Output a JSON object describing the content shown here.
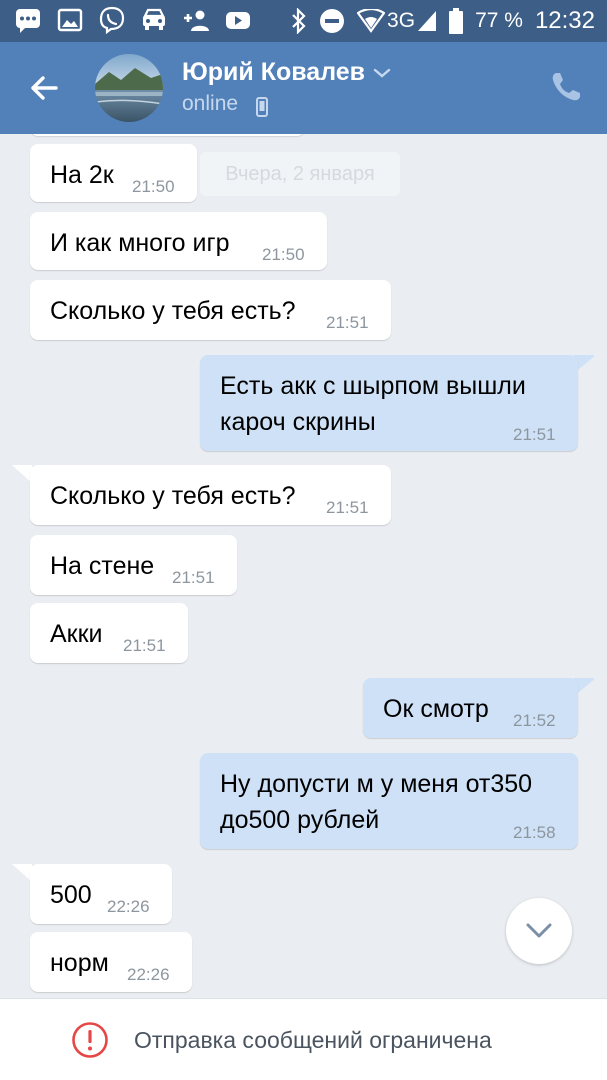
{
  "status_bar": {
    "icons": [
      "chat-bubble-icon",
      "image-icon",
      "viber-icon",
      "car-icon",
      "add-user-icon",
      "youtube-icon",
      "bluetooth-icon",
      "do-not-disturb-icon",
      "wifi-icon"
    ],
    "network": "3G",
    "battery": "77 %",
    "time": "12:32"
  },
  "header": {
    "name": "Юрий Ковалев",
    "presence": "online"
  },
  "chat": {
    "date_label": "Вчера, 2 января",
    "messages": [
      {
        "side": "in",
        "text": "На 2к",
        "time": "21:50"
      },
      {
        "side": "in",
        "text": "И как много игр",
        "time": "21:50"
      },
      {
        "side": "in",
        "text": "Сколько у тебя есть?",
        "time": "21:51"
      },
      {
        "side": "out",
        "lines": [
          "Есть акк с шырпом вышли",
          "кароч скрины"
        ],
        "time": "21:51"
      },
      {
        "side": "in",
        "text": "Сколько у тебя есть?",
        "time": "21:51"
      },
      {
        "side": "in",
        "text": "На стене",
        "time": "21:51"
      },
      {
        "side": "in",
        "text": "Акки",
        "time": "21:51"
      },
      {
        "side": "out",
        "text": "Ок смотр",
        "time": "21:52"
      },
      {
        "side": "out",
        "lines": [
          "Ну допусти м у меня от350",
          "до500 рублей"
        ],
        "time": "21:58"
      },
      {
        "side": "in",
        "text": "500",
        "time": "22:26"
      },
      {
        "side": "in",
        "text": "норм",
        "time": "22:26"
      }
    ]
  },
  "bottom_bar": {
    "message": "Отправка сообщений ограничена"
  },
  "colors": {
    "status_bar": "#3d5e87",
    "header": "#5181b8",
    "chat_bg": "#eaeef2",
    "bubble_in": "#ffffff",
    "bubble_out": "#cfe1f6",
    "warning": "#e64646"
  }
}
